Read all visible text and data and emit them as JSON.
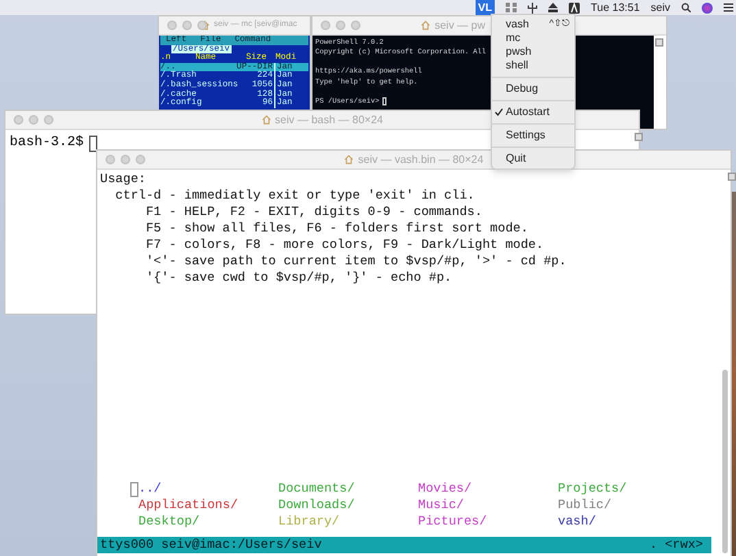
{
  "menu_bar": {
    "app_badge": "VL",
    "clock": "Tue 13:51",
    "user": "seiv"
  },
  "status_menu": {
    "items": [
      {
        "kind": "item",
        "label": "vash",
        "shortcut": "^⇧⎋",
        "checked": false
      },
      {
        "kind": "item",
        "label": "mc",
        "checked": false
      },
      {
        "kind": "item",
        "label": "pwsh",
        "checked": false
      },
      {
        "kind": "item",
        "label": "shell",
        "checked": false
      },
      {
        "kind": "separator"
      },
      {
        "kind": "item",
        "label": "Debug",
        "checked": false
      },
      {
        "kind": "separator"
      },
      {
        "kind": "item",
        "label": "Autostart",
        "checked": true
      },
      {
        "kind": "separator"
      },
      {
        "kind": "item",
        "label": "Settings",
        "checked": false
      },
      {
        "kind": "separator"
      },
      {
        "kind": "item",
        "label": "Quit",
        "checked": false
      }
    ]
  },
  "mc_window": {
    "title": "seiv — mc [seiv@imac",
    "menu": [
      "Left",
      "File",
      "Command"
    ],
    "path": "/Users/seiv",
    "columns": [
      ".n",
      "Name",
      "Size",
      "Modi"
    ],
    "rows": [
      {
        "name": "/..",
        "size": "UP--DIR",
        "modified": "Jan",
        "selected": true
      },
      {
        "name": "/.Trash",
        "size": "224",
        "modified": "Jan",
        "selected": false
      },
      {
        "name": "/.bash_sessions",
        "size": "1056",
        "modified": "Jan",
        "selected": false
      },
      {
        "name": "/.cache",
        "size": "128",
        "modified": "Jan",
        "selected": false
      },
      {
        "name": "/.config",
        "size": "96",
        "modified": "Jan",
        "selected": false
      }
    ]
  },
  "pwsh_window": {
    "title": "seiv — pw",
    "blocks": [
      [
        "PowerShell 7.0.2",
        "Copyright (c) Microsoft Corporation. All"
      ],
      [
        "https://aka.ms/powershell",
        "Type 'help' to get help."
      ],
      [
        "PS /Users/seiv>"
      ]
    ]
  },
  "bash_window": {
    "title": "seiv — bash — 80×24",
    "prompt": "bash-3.2$"
  },
  "vash_window": {
    "title": "seiv — vash.bin — 80×24",
    "usage": [
      "Usage:",
      "  ctrl-d - immediatly exit or type 'exit' in cli.",
      "      F1 - HELP, F2 - EXIT, digits 0-9 - commands.",
      "      F5 - show all files, F6 - folders first sort mode.",
      "      F7 - colors, F8 - more colors, F9 - Dark/Light mode.",
      "      '<'- save path to current item to $vsp/#p, '>' - cd #p.",
      "      '{'- save cwd to $vsp/#p, '}' - echo #p."
    ],
    "files": [
      {
        "name": "../",
        "color": "#3a3ad6",
        "selected": true
      },
      {
        "name": "Applications/",
        "color": "#c8383a",
        "selected": false
      },
      {
        "name": "Desktop/",
        "color": "#3ca83c",
        "selected": false
      },
      {
        "name": "Documents/",
        "color": "#3ca83c",
        "selected": false
      },
      {
        "name": "Downloads/",
        "color": "#3ca83c",
        "selected": false
      },
      {
        "name": "Library/",
        "color": "#b0b048",
        "selected": false
      },
      {
        "name": "Movies/",
        "color": "#c43cc4",
        "selected": false
      },
      {
        "name": "Music/",
        "color": "#c43cc4",
        "selected": false
      },
      {
        "name": "Pictures/",
        "color": "#c43cc4",
        "selected": false
      },
      {
        "name": "Projects/",
        "color": "#3ca83c",
        "selected": false
      },
      {
        "name": "Public/",
        "color": "#808080",
        "selected": false
      },
      {
        "name": "vash/",
        "color": "#3a3aa8",
        "selected": false
      }
    ],
    "status_left": "ttys000 seiv@imac:/Users/seiv",
    "status_right": ". <rwx>"
  }
}
